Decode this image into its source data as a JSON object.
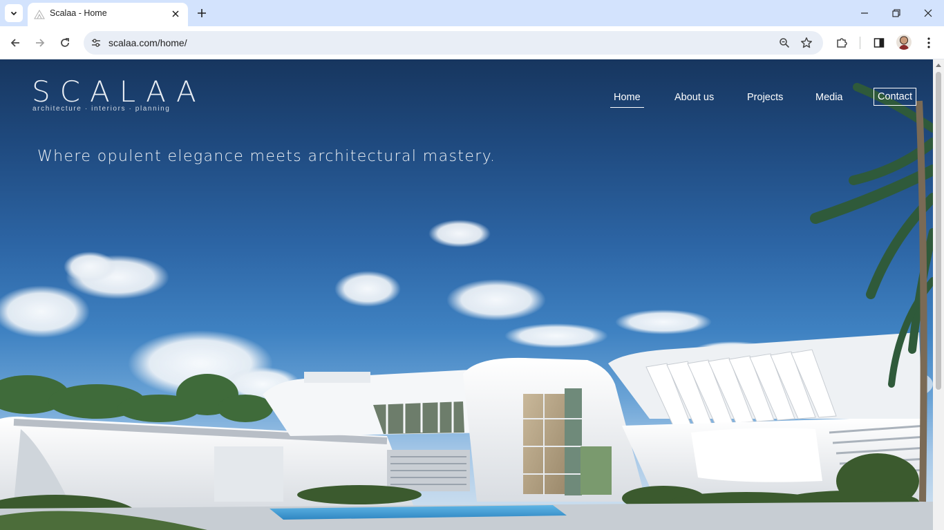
{
  "browser": {
    "tab": {
      "title": "Scalaa - Home",
      "favicon": "scalaa-logo-icon"
    },
    "address_bar": {
      "url": "scalaa.com/home/"
    },
    "icons": {
      "tab_list": "chevron-down-icon",
      "close_tab": "close-icon",
      "new_tab": "plus-icon",
      "minimize": "minimize-icon",
      "restore": "restore-icon",
      "close_window": "close-icon",
      "back": "arrow-left-icon",
      "forward": "arrow-right-icon",
      "reload": "reload-icon",
      "site_info": "tune-icon",
      "zoom": "zoom-icon",
      "bookmark": "star-icon",
      "extensions": "puzzle-icon",
      "side_panel": "side-panel-icon",
      "profile": "avatar",
      "menu": "kebab-menu-icon"
    }
  },
  "site": {
    "logo": {
      "wordmark": "SCALAA",
      "tagline": "architecture · interiors · planning"
    },
    "nav": {
      "home": "Home",
      "about": "About us",
      "projects": "Projects",
      "media": "Media",
      "contact": "Contact",
      "active": "Home"
    },
    "hero": {
      "headline": "Where opulent elegance meets architectural mastery."
    }
  },
  "colors": {
    "tabstrip": "#d3e3fd",
    "omnibox": "#e9eef6",
    "sky_top": "#17365f",
    "sky_mid": "#3f82c2",
    "building": "#f2f4f6",
    "nav_text": "#ffffff"
  }
}
